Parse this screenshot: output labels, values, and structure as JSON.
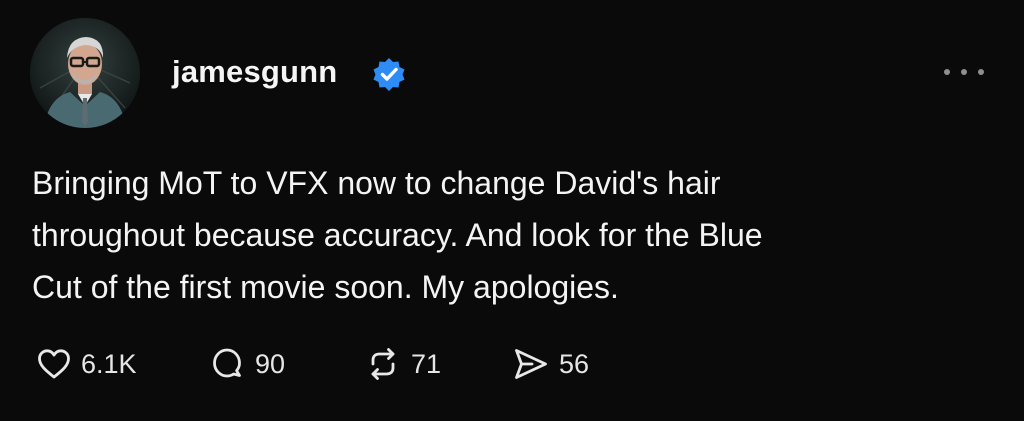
{
  "post": {
    "username": "jamesgunn",
    "text_lines": [
      "Bringing MoT to VFX now to change David's hair",
      "throughout because accuracy. And look for the Blue",
      "Cut of the first movie soon. My apologies."
    ],
    "actions": {
      "likes": "6.1K",
      "replies": "90",
      "reposts": "71",
      "shares": "56"
    }
  },
  "icons": {
    "verified": "verified-badge-icon",
    "more": "more-options-icon",
    "like": "heart-icon",
    "reply": "comment-bubble-icon",
    "repost": "repost-icon",
    "share": "send-icon"
  },
  "colors": {
    "background": "#0a0a0a",
    "text": "#f4f4f4",
    "verified": "#2f8cf5",
    "muted": "#8f8f8f"
  }
}
